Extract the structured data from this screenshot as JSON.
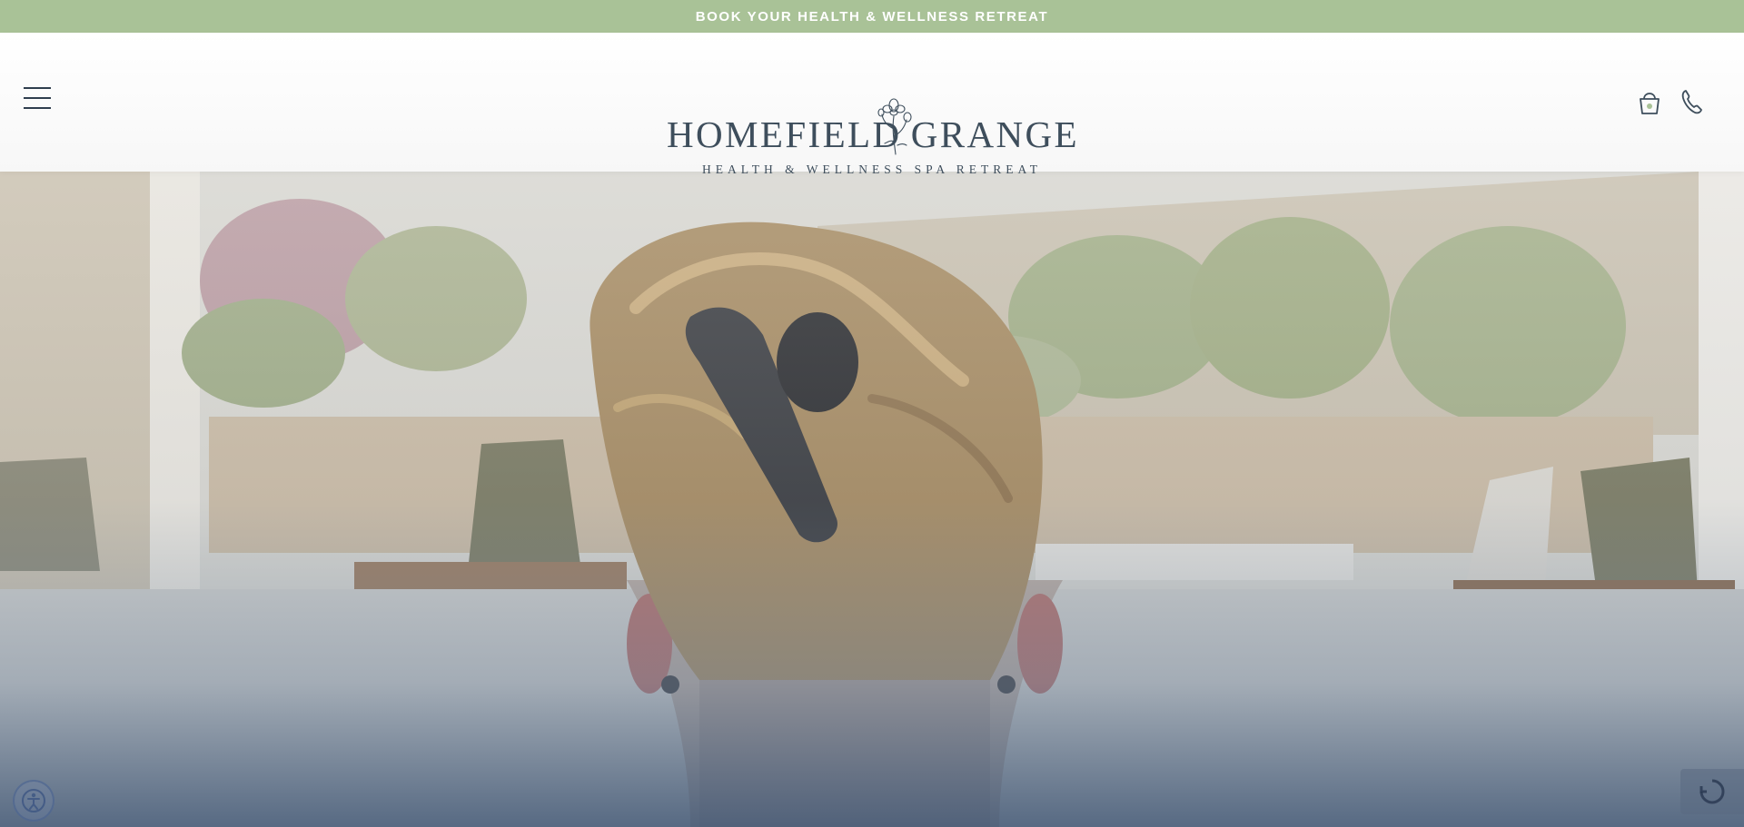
{
  "banner": {
    "link_text": "BOOK YOUR HEALTH & WELLNESS RETREAT",
    "background_color": "#a9c297"
  },
  "header": {
    "logo": {
      "word_left": "HOMEFIELD",
      "word_right": "GRANGE",
      "tagline": "HEALTH & WELLNESS SPA RETREAT"
    },
    "menu_icon": "hamburger-menu-icon",
    "icons": [
      "basket-icon",
      "phone-icon"
    ],
    "text_color": "#3e4e5c"
  },
  "hero": {
    "image_description_icon": "hero-photo",
    "overlay_color_bottom": "#425876"
  },
  "widgets": {
    "accessibility_icon": "accessibility-icon",
    "recaptcha_icon": "recaptcha-icon"
  }
}
